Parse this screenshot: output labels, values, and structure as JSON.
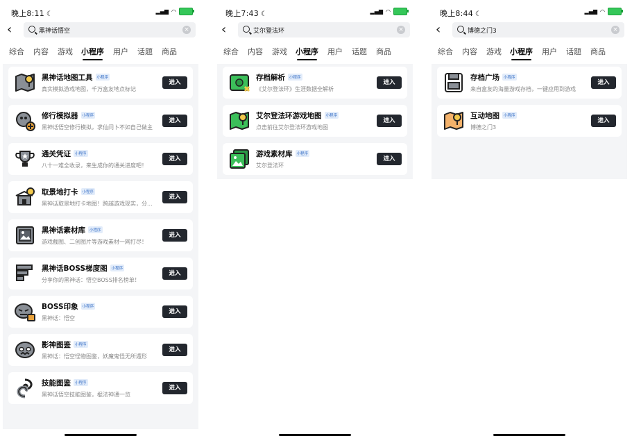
{
  "panels": [
    {
      "time": "晚上8:11",
      "query": "黑神话悟空",
      "tabs": [
        "综合",
        "内容",
        "游戏",
        "小程序",
        "用户",
        "话题",
        "商品"
      ],
      "active_tab": 3,
      "badge": "小程序",
      "enter": "进入",
      "items": [
        {
          "title": "黑神话地图工具",
          "desc": "真实模拟游戏地图，千万盒友地点标记",
          "icon": "map-pin-icon"
        },
        {
          "title": "修行模拟器",
          "desc": "黑神话悟空修行模拟，求仙问卜不如自己做主",
          "icon": "monkey-plus-icon"
        },
        {
          "title": "通关凭证",
          "desc": "八十一难全收录，来生成你的通关进度吧！",
          "icon": "trophy-icon"
        },
        {
          "title": "取景地打卡",
          "desc": "黑神话取景地打卡地图！跨越游戏现实，分...",
          "icon": "temple-pin-icon"
        },
        {
          "title": "黑神话素材库",
          "desc": "游戏截图、二创图片等游戏素材一网打尽！",
          "icon": "image-gallery-icon"
        },
        {
          "title": "黑神话BOSS梯度图",
          "desc": "分享你的黑神话：悟空BOSS排名榜单！",
          "icon": "ranking-bars-icon"
        },
        {
          "title": "BOSS印象",
          "desc": "黑神话：悟空",
          "icon": "boss-mask-icon"
        },
        {
          "title": "影神图鉴",
          "desc": "黑神话：悟空怪物图鉴，妖魔鬼怪无所遁形",
          "icon": "monster-face-icon"
        },
        {
          "title": "技能图鉴",
          "desc": "黑神话悟空技能图鉴，棍法神通一览",
          "icon": "swirl-skill-icon"
        }
      ]
    },
    {
      "time": "晚上7:43",
      "query": "艾尔登法环",
      "tabs": [
        "综合",
        "内容",
        "游戏",
        "小程序",
        "用户",
        "话题",
        "商品"
      ],
      "active_tab": 3,
      "badge": "小程序",
      "enter": "进入",
      "items": [
        {
          "title": "存档解析",
          "desc": "《艾尔登法环》生涯数据全解析",
          "icon": "save-analysis-icon"
        },
        {
          "title": "艾尔登法环游戏地图",
          "desc": "点击前往艾尔登法环游戏地图",
          "icon": "green-map-pin-icon"
        },
        {
          "title": "游戏素材库",
          "desc": "艾尔登法环",
          "icon": "green-gallery-icon"
        }
      ]
    },
    {
      "time": "晚上8:44",
      "query": "博德之门3",
      "tabs": [
        "综合",
        "内容",
        "游戏",
        "小程序",
        "用户",
        "话题",
        "商品"
      ],
      "active_tab": 3,
      "badge": "小程序",
      "enter": "进入",
      "items": [
        {
          "title": "存档广场",
          "desc": "来自盒友的海量游戏存档，一键应用到游戏",
          "icon": "save-plaza-icon"
        },
        {
          "title": "互动地图",
          "desc": "博德之门3",
          "icon": "orange-map-pin-icon"
        }
      ]
    }
  ]
}
